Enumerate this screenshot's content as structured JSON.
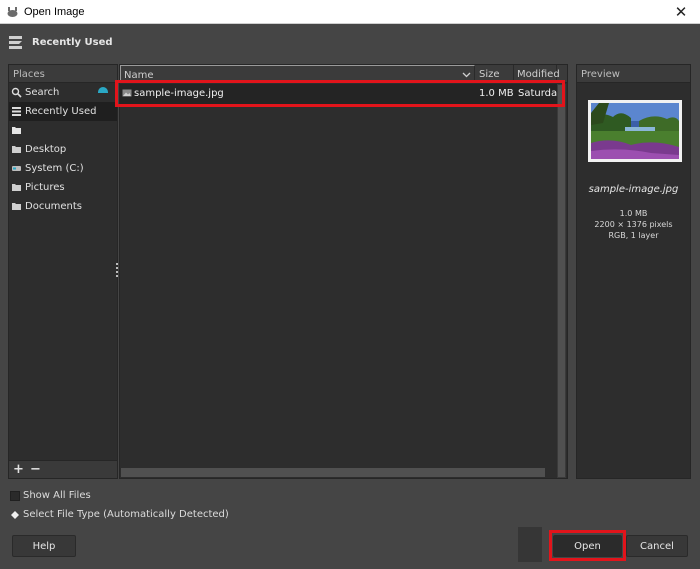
{
  "window": {
    "title": "Open Image",
    "close_glyph": "✕"
  },
  "header": {
    "title": "Recently Used",
    "icon": "recent-stack-icon"
  },
  "places": {
    "title": "Places",
    "items": [
      {
        "label": "Search",
        "icon": "search-icon"
      },
      {
        "label": "Recently Used",
        "icon": "recent-icon",
        "selected": true
      },
      {
        "label": "",
        "icon": "folder-icon"
      },
      {
        "label": "Desktop",
        "icon": "folder-icon"
      },
      {
        "label": "System (C:)",
        "icon": "drive-icon"
      },
      {
        "label": "Pictures",
        "icon": "folder-icon"
      },
      {
        "label": "Documents",
        "icon": "folder-icon"
      }
    ],
    "add_label": "+",
    "remove_label": "−"
  },
  "files": {
    "columns": {
      "name": "Name",
      "size": "Size",
      "modified": "Modified"
    },
    "rows": [
      {
        "name": "sample-image.jpg",
        "size": "1.0 MB",
        "modified": "Saturday",
        "icon": "image-file-icon"
      }
    ]
  },
  "preview": {
    "title": "Preview",
    "filename": "sample-image.jpg",
    "size": "1.0 MB",
    "dimensions": "2200 × 1376 pixels",
    "mode": "RGB, 1 layer"
  },
  "options": {
    "show_all_files": "Show All Files",
    "select_file_type": "Select File Type (Automatically Detected)"
  },
  "buttons": {
    "help": "Help",
    "open": "Open",
    "cancel": "Cancel"
  },
  "colors": {
    "highlight": "#e2141b",
    "background": "#454545",
    "panel": "#2d2d2d"
  }
}
